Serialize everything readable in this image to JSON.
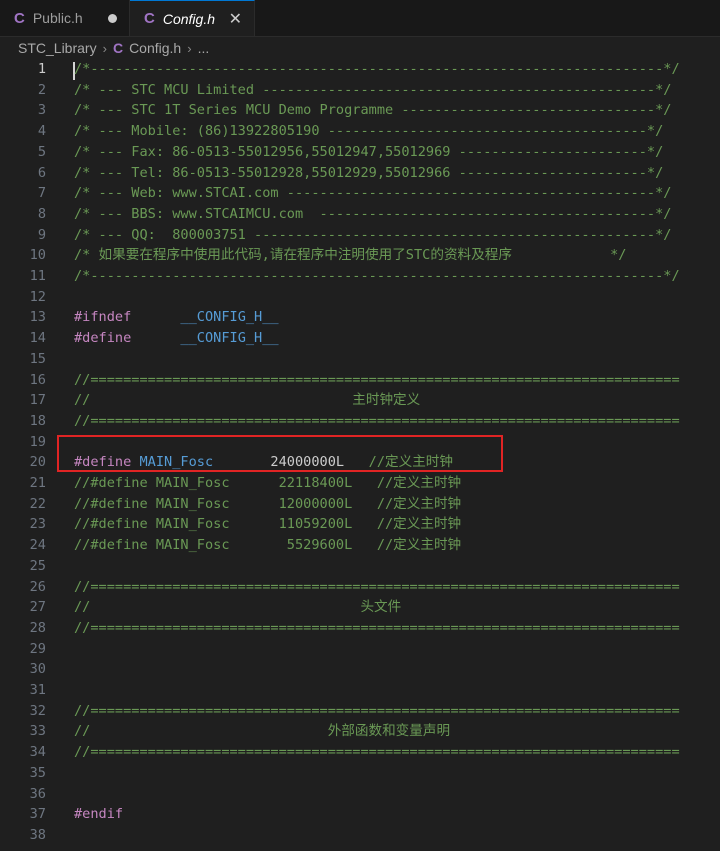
{
  "tabs": [
    {
      "label": "Public.h",
      "icon": "C",
      "modified": true
    },
    {
      "label": "Config.h",
      "icon": "C",
      "close": "✕"
    }
  ],
  "breadcrumb": {
    "folder": "STC_Library",
    "icon": "C",
    "file": "Config.h",
    "more": "..."
  },
  "code_lines": [
    {
      "num": "1",
      "segs": [
        {
          "t": "/*----------------------------------------------------------------------*/",
          "c": "cmt"
        }
      ]
    },
    {
      "num": "2",
      "segs": [
        {
          "t": "/* --- STC MCU Limited ------------------------------------------------*/",
          "c": "cmt"
        }
      ]
    },
    {
      "num": "3",
      "segs": [
        {
          "t": "/* --- STC 1T Series MCU Demo Programme -------------------------------*/",
          "c": "cmt"
        }
      ]
    },
    {
      "num": "4",
      "segs": [
        {
          "t": "/* --- Mobile: (86)13922805190 ---------------------------------------*/",
          "c": "cmt"
        }
      ]
    },
    {
      "num": "5",
      "segs": [
        {
          "t": "/* --- Fax: 86-0513-55012956,55012947,55012969 -----------------------*/",
          "c": "cmt"
        }
      ]
    },
    {
      "num": "6",
      "segs": [
        {
          "t": "/* --- Tel: 86-0513-55012928,55012929,55012966 -----------------------*/",
          "c": "cmt"
        }
      ]
    },
    {
      "num": "7",
      "segs": [
        {
          "t": "/* --- Web: www.STCAI.com ---------------------------------------------*/",
          "c": "cmt"
        }
      ]
    },
    {
      "num": "8",
      "segs": [
        {
          "t": "/* --- BBS: www.STCAIMCU.com  -----------------------------------------*/",
          "c": "cmt"
        }
      ]
    },
    {
      "num": "9",
      "segs": [
        {
          "t": "/* --- QQ:  800003751 -------------------------------------------------*/",
          "c": "cmt"
        }
      ]
    },
    {
      "num": "10",
      "segs": [
        {
          "t": "/* 如果要在程序中使用此代码,请在程序中注明使用了STC的资料及程序            */",
          "c": "cmt"
        }
      ]
    },
    {
      "num": "11",
      "segs": [
        {
          "t": "/*----------------------------------------------------------------------*/",
          "c": "cmt"
        }
      ]
    },
    {
      "num": "12",
      "segs": []
    },
    {
      "num": "13",
      "segs": [
        {
          "t": "#ifndef",
          "c": "kw"
        },
        {
          "t": "      __CONFIG_H__",
          "c": "macro"
        }
      ]
    },
    {
      "num": "14",
      "segs": [
        {
          "t": "#define",
          "c": "kw"
        },
        {
          "t": "      __CONFIG_H__",
          "c": "macro"
        }
      ]
    },
    {
      "num": "15",
      "segs": []
    },
    {
      "num": "16",
      "segs": [
        {
          "t": "//========================================================================",
          "c": "cmt"
        }
      ]
    },
    {
      "num": "17",
      "segs": [
        {
          "t": "//                                主时钟定义",
          "c": "cmt"
        }
      ]
    },
    {
      "num": "18",
      "segs": [
        {
          "t": "//========================================================================",
          "c": "cmt"
        }
      ]
    },
    {
      "num": "19",
      "segs": []
    },
    {
      "num": "20",
      "segs": [
        {
          "t": "#define",
          "c": "kw"
        },
        {
          "t": " MAIN_Fosc",
          "c": "macro"
        },
        {
          "t": "       24000000L",
          "c": "plain"
        },
        {
          "t": "   //定义主时钟",
          "c": "cmt"
        }
      ]
    },
    {
      "num": "21",
      "segs": [
        {
          "t": "//#define MAIN_Fosc      22118400L   //定义主时钟",
          "c": "cmt"
        }
      ]
    },
    {
      "num": "22",
      "segs": [
        {
          "t": "//#define MAIN_Fosc      12000000L   //定义主时钟",
          "c": "cmt"
        }
      ]
    },
    {
      "num": "23",
      "segs": [
        {
          "t": "//#define MAIN_Fosc      11059200L   //定义主时钟",
          "c": "cmt"
        }
      ]
    },
    {
      "num": "24",
      "segs": [
        {
          "t": "//#define MAIN_Fosc       5529600L   //定义主时钟",
          "c": "cmt"
        }
      ]
    },
    {
      "num": "25",
      "segs": []
    },
    {
      "num": "26",
      "segs": [
        {
          "t": "//========================================================================",
          "c": "cmt"
        }
      ]
    },
    {
      "num": "27",
      "segs": [
        {
          "t": "//                                 头文件",
          "c": "cmt"
        }
      ]
    },
    {
      "num": "28",
      "segs": [
        {
          "t": "//========================================================================",
          "c": "cmt"
        }
      ]
    },
    {
      "num": "29",
      "segs": []
    },
    {
      "num": "30",
      "segs": []
    },
    {
      "num": "31",
      "segs": []
    },
    {
      "num": "32",
      "segs": [
        {
          "t": "//========================================================================",
          "c": "cmt"
        }
      ]
    },
    {
      "num": "33",
      "segs": [
        {
          "t": "//                             外部函数和变量声明",
          "c": "cmt"
        }
      ]
    },
    {
      "num": "34",
      "segs": [
        {
          "t": "//========================================================================",
          "c": "cmt"
        }
      ]
    },
    {
      "num": "35",
      "segs": []
    },
    {
      "num": "36",
      "segs": []
    },
    {
      "num": "37",
      "segs": [
        {
          "t": "#endif",
          "c": "kw"
        }
      ]
    },
    {
      "num": "38",
      "segs": []
    }
  ],
  "colors": {
    "comment": "#6a9955",
    "keyword": "#c586c0",
    "macro": "#569cd6",
    "highlight_box": "#e02424",
    "c_icon": "#a074c4"
  }
}
